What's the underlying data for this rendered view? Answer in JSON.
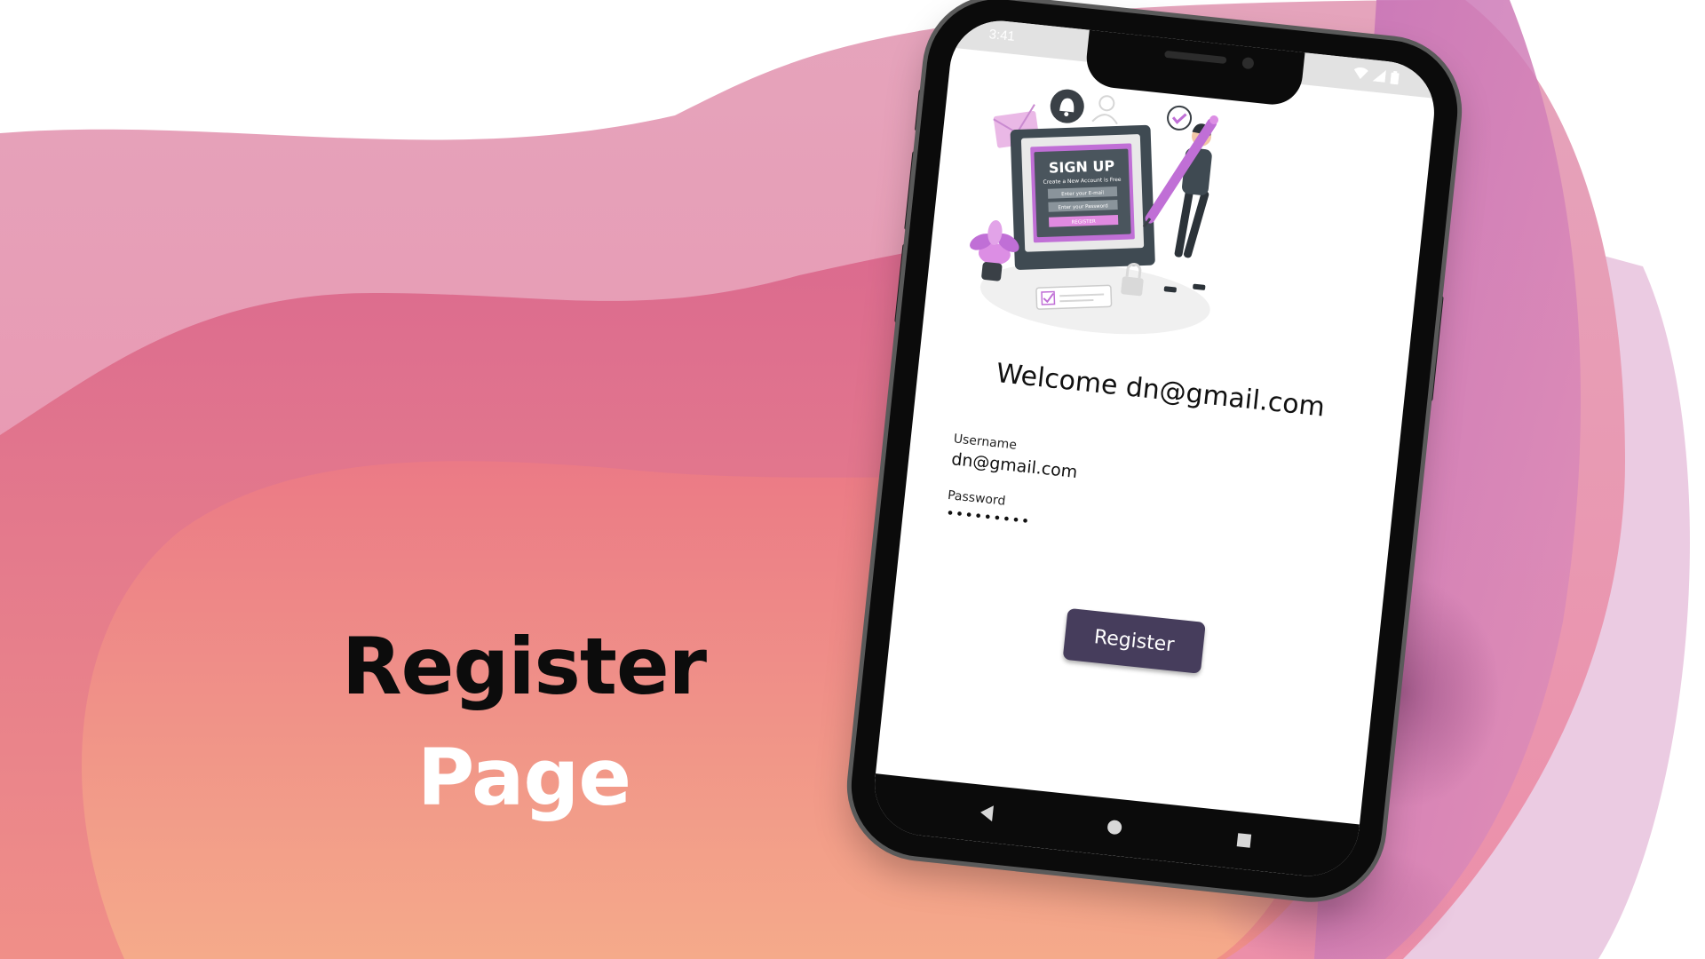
{
  "hero": {
    "title_line1": "Register",
    "title_line2": "Page"
  },
  "phone": {
    "status_time": "3:41",
    "icons": [
      "wifi-icon",
      "signal-icon",
      "battery-icon"
    ],
    "illustration": {
      "heading": "SIGN UP",
      "subheading": "Create a New Account is Free",
      "email_placeholder": "Enter your E-mail",
      "password_placeholder": "Enter your Password",
      "button": "REGISTER"
    },
    "welcome": "Welcome dn@gmail.com",
    "username_label": "Username",
    "username_value": "dn@gmail.com",
    "password_label": "Password",
    "password_value": "•••••••••",
    "register_button": "Register",
    "nav": [
      "back-icon",
      "home-icon",
      "recents-icon"
    ]
  },
  "colors": {
    "button": "#463d5c",
    "accent_pink": "#e07a9b",
    "accent_purple": "#c06fd6",
    "bg_peach": "#f4a88c"
  }
}
